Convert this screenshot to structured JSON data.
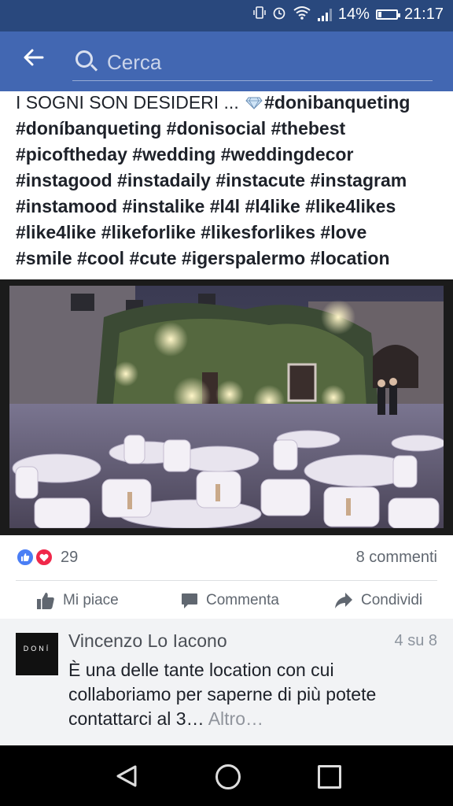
{
  "status_bar": {
    "battery": "14%",
    "time": "21:17"
  },
  "search": {
    "placeholder": "Cerca"
  },
  "post": {
    "text_plain": "I SOGNI SON DESIDERI ... ",
    "line1_tag": "#donibanqueting",
    "line2": "#doníbanqueting #donisocial #thebest",
    "line3": "#picoftheday #wedding #weddingdecor",
    "line4": "#instagood #instadaily #instacute #instagram",
    "line5": "#instamood #instalike #l4l #l4like #like4likes",
    "line6": "#like4like #likeforlike #likesforlikes #love",
    "line7": "#smile #cool #cute #igerspalermo #location"
  },
  "reactions": {
    "count": "29",
    "comments": "8 commenti"
  },
  "actions": {
    "like": "Mi piace",
    "comment": "Commenta",
    "share": "Condividi"
  },
  "comment": {
    "avatar_text": "DONÍ",
    "author": "Vincenzo Lo Iacono",
    "position": "4 su 8",
    "body": "È una delle tante location con cui collaboriamo per saperne di più potete contattarci al 3… ",
    "more": "Altro…"
  },
  "colors": {
    "header": "#4267b2",
    "status": "#29487d",
    "like_blue": "#4a7ef5",
    "love_red": "#f0284a"
  }
}
